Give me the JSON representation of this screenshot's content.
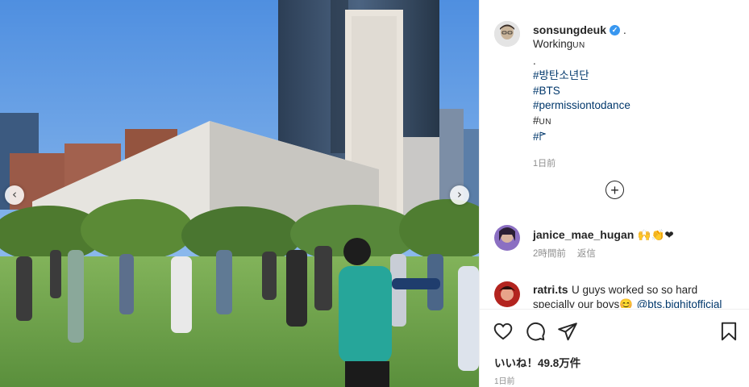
{
  "post": {
    "username": "sonsungdeuk",
    "verified_mark": "✓",
    "header_suffix": ".",
    "caption_line1": "Working",
    "caption_line1_suffix": "UN",
    "caption_line2": ".",
    "tags": [
      "#방탄소년단",
      "#BTS",
      "#permissiontodance"
    ],
    "tag_un_prefix": "#",
    "tag_un_suffix": "UN",
    "tag_flag": "#",
    "time_ago": "1日前"
  },
  "comments": [
    {
      "username": "janice_mae_hugan",
      "text": "🙌👏❤",
      "time": "2時間前",
      "reply_label": "返信"
    },
    {
      "username": "ratri.ts",
      "text": "U guys worked so so hard specially our boys😊",
      "mention": "@bts.bighitofficial"
    }
  ],
  "likes_label": "いいね！49.8万件",
  "date_label": "1日前",
  "icons": {
    "prev": "chevron-left-icon",
    "next": "chevron-right-icon",
    "load_more": "plus-circle-icon",
    "like": "heart-icon",
    "comment": "comment-icon",
    "share": "share-icon",
    "save": "bookmark-icon"
  },
  "colors": {
    "tag": "#00376b",
    "verified": "#3897f0",
    "sky": "#6aa7e8",
    "grass": "#6fa04a"
  }
}
